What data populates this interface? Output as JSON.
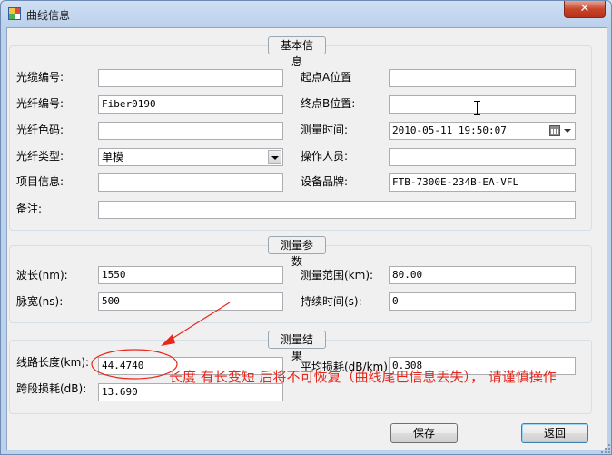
{
  "window": {
    "title": "曲线信息",
    "close_label": "✕"
  },
  "basic_info": {
    "title": "基本信息",
    "cable_no_label": "光缆编号:",
    "cable_no_value": "",
    "fiber_no_label": "光纤编号:",
    "fiber_no_value": "Fiber0190",
    "fiber_color_label": "光纤色码:",
    "fiber_color_value": "",
    "fiber_type_label": "光纤类型:",
    "fiber_type_value": "单模",
    "project_label": "项目信息:",
    "project_value": "",
    "remark_label": "备注:",
    "remark_value": "",
    "start_label": "起点A位置",
    "start_value": "",
    "end_label": "终点B位置:",
    "end_value": "",
    "measure_time_label": "测量时间:",
    "measure_time_value": "2010-05-11 19:50:07",
    "operator_label": "操作人员:",
    "operator_value": "",
    "device_label": "设备品牌:",
    "device_value": "FTB-7300E-234B-EA-VFL"
  },
  "params": {
    "title": "测量参数",
    "wavelength_label": "波长(nm):",
    "wavelength_value": "1550",
    "pulse_label": "脉宽(ns):",
    "pulse_value": "500",
    "range_label": "测量范围(km):",
    "range_value": "80.00",
    "duration_label": "持续时间(s):",
    "duration_value": "0"
  },
  "results": {
    "title": "测量结果",
    "length_label": "线路长度(km):",
    "length_value": "44.4740",
    "span_loss_label": "跨段损耗(dB):",
    "span_loss_value": "13.690",
    "avg_loss_label": "平均损耗(dB/km):",
    "avg_loss_value": "0.308"
  },
  "annotation": {
    "warning_text": "长度 有长变短 后将不可恢复（曲线尾巴信息丢失）， 请谨慎操作",
    "color": "#e8261a"
  },
  "buttons": {
    "save_label": "保存",
    "back_label": "返回"
  }
}
